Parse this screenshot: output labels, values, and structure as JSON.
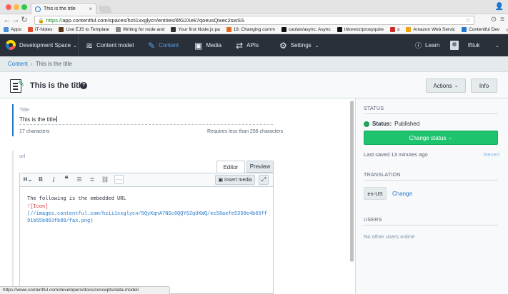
{
  "browser": {
    "tab_title": "This is the title",
    "url_scheme": "https://",
    "url_rest": "app.contentful.com/spaces/hzii1xxglycn/entries/6fG2Xek7qoeusQwec2swSS",
    "bookmarks": [
      {
        "label": "Apps",
        "color": "#4a90d9"
      },
      {
        "label": "IT-Notes",
        "color": "#e04c2c"
      },
      {
        "label": "Use EJS to Template",
        "color": "#5b3b1b"
      },
      {
        "label": "Writing for node and",
        "color": "#888888"
      },
      {
        "label": "Your first Node.js pa",
        "color": "#333333"
      },
      {
        "label": "19. Changing comm",
        "color": "#e06a1b"
      },
      {
        "label": "caolan/async: Async",
        "color": "#111111"
      },
      {
        "label": "thlorenz/proxyquire",
        "color": "#111111"
      },
      {
        "label": "s",
        "color": "#d02b2b"
      },
      {
        "label": "Amazon Web Servic",
        "color": "#f0a30a"
      },
      {
        "label": "Contentful Dev",
        "color": "#2478cc"
      }
    ],
    "bookmarks_more": "»",
    "status_url": "https://www.contentful.com/developers/docs/concepts/data-model/"
  },
  "topnav": {
    "space_label": "Development Space",
    "items": [
      {
        "label": "Content model",
        "icon": "layers-icon"
      },
      {
        "label": "Content",
        "icon": "content-icon"
      },
      {
        "label": "Media",
        "icon": "image-icon"
      },
      {
        "label": "APIs",
        "icon": "api-icon"
      },
      {
        "label": "Settings",
        "icon": "gear-icon"
      }
    ],
    "learn_label": "Learn",
    "user_name": "lftiuk"
  },
  "breadcrumb": {
    "root": "Content",
    "separator": "›",
    "current": "This is the title"
  },
  "entry": {
    "title": "This is the title",
    "actions_label": "Actions",
    "info_label": "Info"
  },
  "fields": {
    "title": {
      "label": "Title",
      "value": "This is the title",
      "char_count": "17 characters",
      "char_limit": "Requires less than 256 characters"
    },
    "url": {
      "label": "url",
      "tab_editor": "Editor",
      "tab_preview": "Preview",
      "insert_media": "Insert media",
      "lines": [
        "The following is the embedded URL",
        "![Icon]",
        "(//images.contentful.com/hzii1xxglycn/5QyKqnA7NSc6QQY62qUKWQ/ec58aefe5330e4b65ff",
        "91b55b863fb88/fax.png)"
      ]
    }
  },
  "sidebar": {
    "status_heading": "STATUS",
    "status_key": "Status:",
    "status_value": "Published",
    "status_color": "#21a35b",
    "change_status": "Change status",
    "last_saved": "Last saved 13 minutes ago",
    "revert": "Revert",
    "translation_heading": "TRANSLATION",
    "locale": "en-US",
    "change": "Change",
    "users_heading": "USERS",
    "no_users": "No other users online"
  },
  "colors": {
    "nav_bg": "#2a3039",
    "accent_blue": "#2478cc",
    "primary_green": "#1ec36e"
  }
}
